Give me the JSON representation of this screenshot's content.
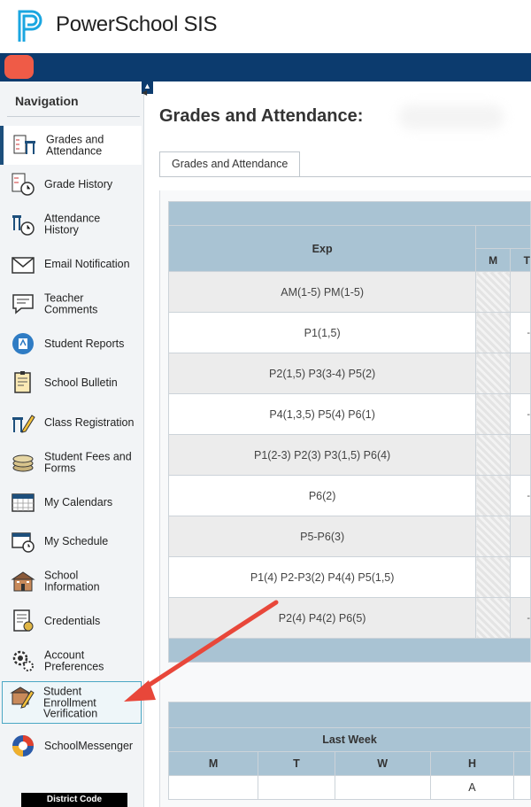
{
  "header": {
    "app_title": "PowerSchool SIS"
  },
  "sidebar": {
    "heading": "Navigation",
    "items": [
      {
        "label": "Grades and Attendance",
        "icon": "grades-attendance-icon"
      },
      {
        "label": "Grade History",
        "icon": "grade-history-icon"
      },
      {
        "label": "Attendance History",
        "icon": "attendance-history-icon"
      },
      {
        "label": "Email Notification",
        "icon": "email-icon"
      },
      {
        "label": "Teacher Comments",
        "icon": "comments-icon"
      },
      {
        "label": "Student Reports",
        "icon": "reports-icon"
      },
      {
        "label": "School Bulletin",
        "icon": "bulletin-icon"
      },
      {
        "label": "Class Registration",
        "icon": "registration-icon"
      },
      {
        "label": "Student Fees and Forms",
        "icon": "fees-icon"
      },
      {
        "label": "My Calendars",
        "icon": "calendar-icon"
      },
      {
        "label": "My Schedule",
        "icon": "schedule-icon"
      },
      {
        "label": "School Information",
        "icon": "school-icon"
      },
      {
        "label": "Credentials",
        "icon": "credentials-icon"
      },
      {
        "label": "Account Preferences",
        "icon": "preferences-icon"
      },
      {
        "label": "Student Enrollment Verification",
        "icon": "enrollment-icon"
      },
      {
        "label": "SchoolMessenger",
        "icon": "schoolmessenger-icon"
      }
    ],
    "district_code": "District Code"
  },
  "main": {
    "title": "Grades and Attendance:",
    "tab": "Grades and Attendance",
    "table": {
      "exp_header": "Exp",
      "day_headers": [
        "M",
        "T"
      ],
      "rows": [
        "AM(1-5) PM(1-5)",
        "P1(1,5)",
        "P2(1,5) P3(3-4) P5(2)",
        "P4(1,3,5) P5(4) P6(1)",
        "P1(2-3) P2(3) P3(1,5) P6(4)",
        "P6(2)",
        "P5-P6(3)",
        "P1(4) P2-P3(2) P4(4) P5(1,5)",
        "P2(4) P4(2) P6(5)"
      ],
      "t_column": [
        "",
        "-",
        "",
        "-",
        "",
        "-",
        "",
        "",
        "-"
      ]
    },
    "lastweek": {
      "heading": "Last Week",
      "days": [
        "M",
        "T",
        "W",
        "H"
      ],
      "values": [
        "",
        "",
        "",
        "A"
      ]
    }
  },
  "colors": {
    "brand_bar": "#0c3b6e",
    "header_blue": "#a9c3d3",
    "arrow_red": "#e8473a"
  }
}
